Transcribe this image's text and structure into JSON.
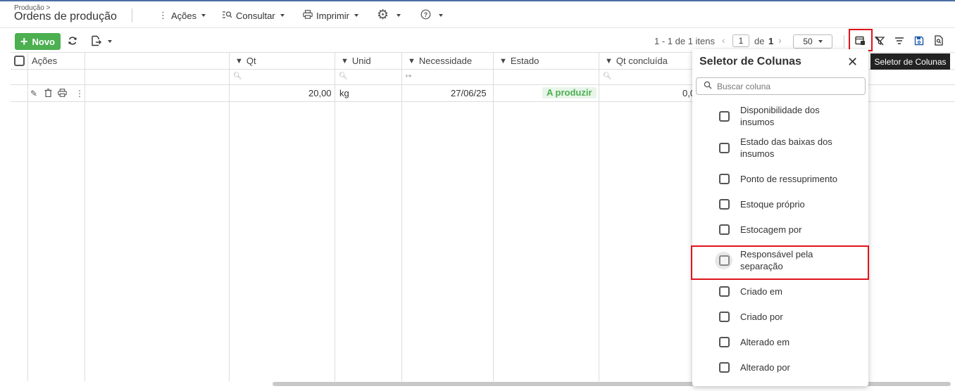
{
  "header": {
    "breadcrumb": "Produção >",
    "title": "Ordens de produção",
    "menus": [
      {
        "label": "Ações",
        "icon": "vertical-dots-icon"
      },
      {
        "label": "Consultar",
        "icon": "search-list-icon"
      },
      {
        "label": "Imprimir",
        "icon": "printer-icon"
      }
    ]
  },
  "toolbar": {
    "new_label": "Novo",
    "pager_text": "1 - 1 de 1 itens",
    "page_current": "1",
    "page_of": "de",
    "page_total": "1",
    "page_size": "50"
  },
  "table": {
    "headers": [
      "Ações",
      "Qt",
      "Unid",
      "Necessidade",
      "Estado",
      "Qt concluída"
    ],
    "row": {
      "qt": "20,00",
      "unid": "kg",
      "necessidade": "27/06/25",
      "estado": "A produzir",
      "qt_concluida": "0,0"
    }
  },
  "column_selector": {
    "title": "Seletor de Colunas",
    "search_placeholder": "Buscar coluna",
    "options": [
      {
        "label": "Disponibilidade dos insumos",
        "checked": false
      },
      {
        "label": "Estado das baixas dos insumos",
        "checked": false
      },
      {
        "label": "Ponto de ressuprimento",
        "checked": false
      },
      {
        "label": "Estoque próprio",
        "checked": false
      },
      {
        "label": "Estocagem por",
        "checked": false
      },
      {
        "label": "Responsável pela separação",
        "checked": false,
        "highlighted": true
      },
      {
        "label": "Criado em",
        "checked": false
      },
      {
        "label": "Criado por",
        "checked": false
      },
      {
        "label": "Alterado em",
        "checked": false
      },
      {
        "label": "Alterado por",
        "checked": false
      }
    ]
  },
  "tooltip": "Seletor de Colunas",
  "colors": {
    "accent_green": "#4caf50",
    "highlight_red": "#e0141c"
  }
}
